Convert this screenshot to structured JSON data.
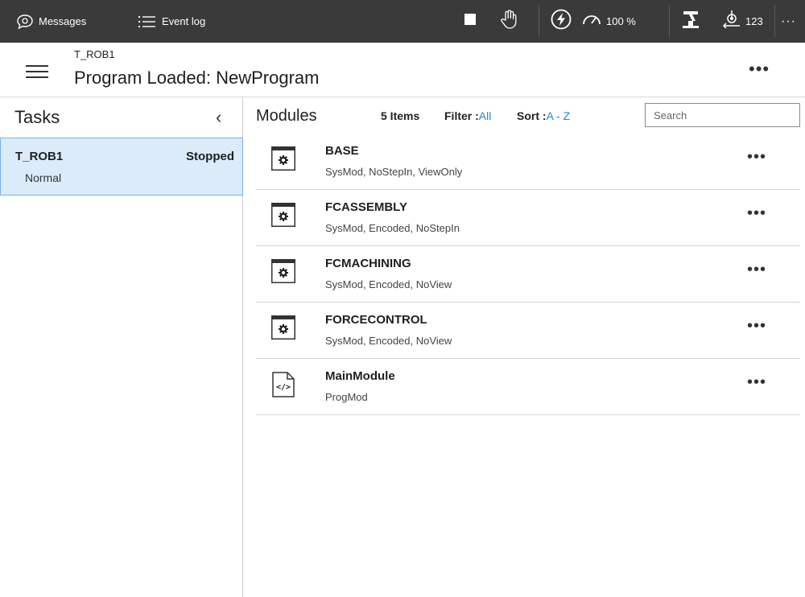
{
  "topbar": {
    "messages_label": "Messages",
    "eventlog_label": "Event log",
    "speed_label": "100 %",
    "jog_count_label": "123",
    "more_label": "···"
  },
  "header": {
    "subtitle": "T_ROB1",
    "title": "Program Loaded: NewProgram",
    "more_label": "•••"
  },
  "tasks": {
    "title": "Tasks",
    "collapse_glyph": "‹",
    "items": [
      {
        "name": "T_ROB1",
        "status": "Stopped",
        "mode": "Normal"
      }
    ]
  },
  "modules": {
    "title": "Modules",
    "count_label": "5 Items",
    "filter_label": "Filter :",
    "filter_value": "All",
    "sort_label": "Sort :",
    "sort_value": "A - Z",
    "search_placeholder": "Search",
    "more_label": "•••",
    "items": [
      {
        "name": "BASE",
        "desc": "SysMod, NoStepIn, ViewOnly",
        "icon": "system-module-icon"
      },
      {
        "name": "FCASSEMBLY",
        "desc": "SysMod, Encoded, NoStepIn",
        "icon": "system-module-icon"
      },
      {
        "name": "FCMACHINING",
        "desc": "SysMod, Encoded, NoView",
        "icon": "system-module-icon"
      },
      {
        "name": "FORCECONTROL",
        "desc": "SysMod, Encoded, NoView",
        "icon": "system-module-icon"
      },
      {
        "name": "MainModule",
        "desc": "ProgMod",
        "icon": "program-module-icon"
      }
    ]
  },
  "colors": {
    "topbar_bg": "#3a3a3a",
    "accent": "#1e86d8",
    "selected_bg": "#dcebfa",
    "selected_border": "#7ab2e8"
  }
}
